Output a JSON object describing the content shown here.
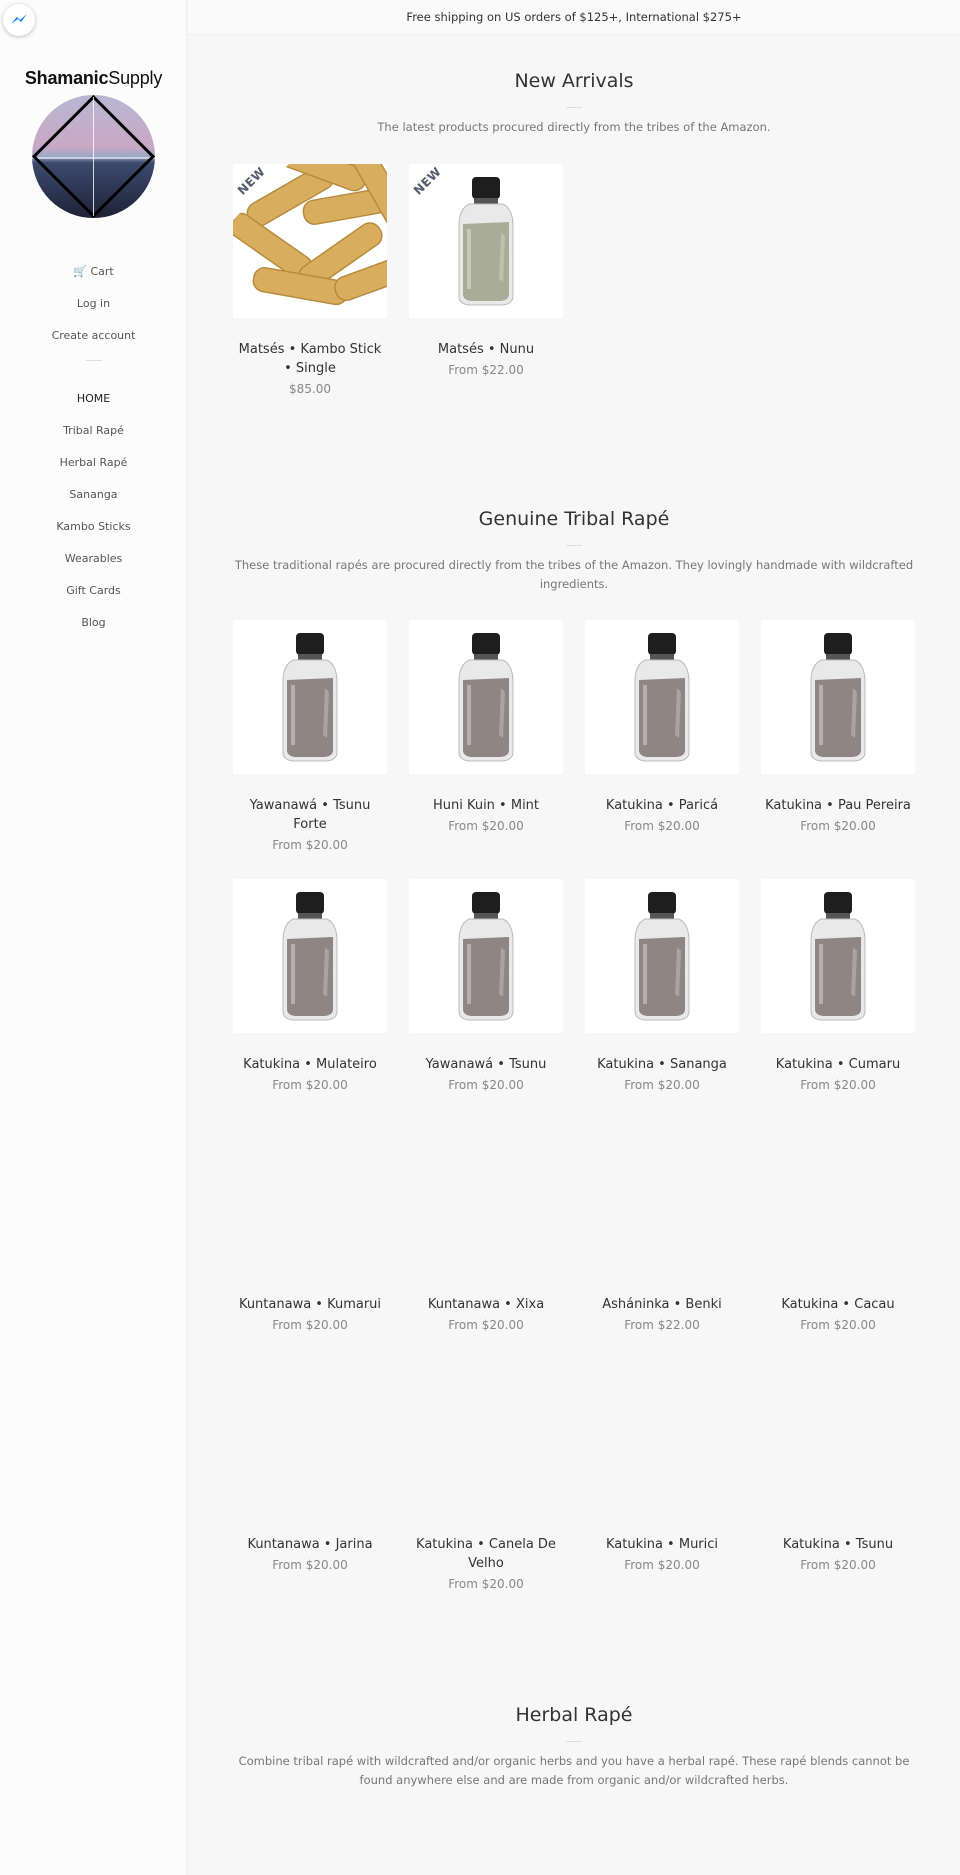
{
  "banner": "Free shipping on US orders of $125+, International $275+",
  "logo": {
    "bold": "Shamanic",
    "light": "Supply"
  },
  "account": {
    "cart": "Cart",
    "login": "Log in",
    "create": "Create account"
  },
  "nav": [
    "HOME",
    "Tribal Rapé",
    "Herbal Rapé",
    "Sananga",
    "Kambo Sticks",
    "Wearables",
    "Gift Cards",
    "Blog"
  ],
  "new_arrivals": {
    "title": "New Arrivals",
    "desc": "The latest products procured directly from the tribes of the Amazon.",
    "badge": "NEW",
    "products": [
      {
        "title": "Matsés • Kambo Stick • Single",
        "price": "$85.00",
        "image": "kambo-sticks"
      },
      {
        "title": "Matsés • Nunu",
        "price": "From $22.00",
        "image": "bottle-green"
      }
    ]
  },
  "tribal": {
    "title": "Genuine Tribal Rapé",
    "desc": "These traditional rapés are procured directly from the tribes of the Amazon.  They lovingly handmade with wildcrafted ingredients.",
    "products": [
      {
        "title": "Yawanawá • Tsunu Forte",
        "price": "From $20.00",
        "image": "bottle"
      },
      {
        "title": "Huni Kuin • Mint",
        "price": "From $20.00",
        "image": "bottle"
      },
      {
        "title": "Katukina • Paricá",
        "price": "From $20.00",
        "image": "bottle"
      },
      {
        "title": "Katukina • Pau Pereira",
        "price": "From $20.00",
        "image": "bottle"
      },
      {
        "title": "Katukina • Mulateiro",
        "price": "From $20.00",
        "image": "bottle"
      },
      {
        "title": "Yawanawá • Tsunu",
        "price": "From $20.00",
        "image": "bottle"
      },
      {
        "title": "Katukina • Sananga",
        "price": "From $20.00",
        "image": "bottle"
      },
      {
        "title": "Katukina • Cumaru",
        "price": "From $20.00",
        "image": "bottle"
      },
      {
        "title": "Kuntanawa • Kumarui",
        "price": "From $20.00",
        "image": "none"
      },
      {
        "title": "Kuntanawa • Xixa",
        "price": "From $20.00",
        "image": "none"
      },
      {
        "title": "Asháninka • Benki",
        "price": "From $22.00",
        "image": "none"
      },
      {
        "title": "Katukina • Cacau",
        "price": "From $20.00",
        "image": "none"
      },
      {
        "title": "Kuntanawa • Jarina",
        "price": "From $20.00",
        "image": "none"
      },
      {
        "title": "Katukina • Canela De Velho",
        "price": "From $20.00",
        "image": "none"
      },
      {
        "title": "Katukina • Murici",
        "price": "From $20.00",
        "image": "none"
      },
      {
        "title": "Katukina • Tsunu",
        "price": "From $20.00",
        "image": "none"
      }
    ]
  },
  "herbal": {
    "title": "Herbal Rapé",
    "desc": "Combine tribal rapé with wildcrafted and/or organic herbs and you have a herbal rapé.  These rapé blends cannot be found anywhere else and are made from organic and/or wildcrafted herbs."
  },
  "colors": {
    "badge_text": "#555a6e",
    "powder": "#8f8583",
    "powder_green": "#a9ac96"
  }
}
